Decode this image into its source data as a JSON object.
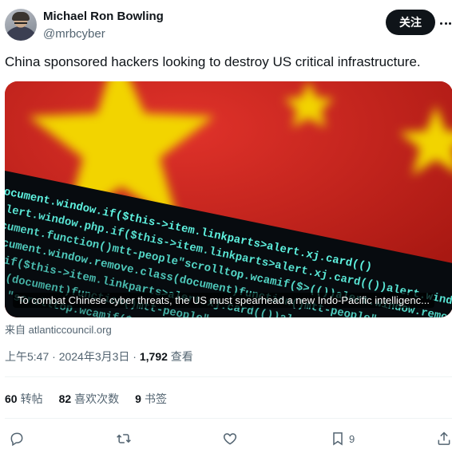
{
  "author": {
    "name": "Michael Ron Bowling",
    "handle": "@mrbcyber",
    "avatar_icon": "avatar-photo"
  },
  "follow_label": "关注",
  "tweet_text": "China sponsored hackers looking to destroy US critical infrastructure.",
  "card": {
    "caption": "To combat Chinese cyber threats, the US must spearhead a new Indo-Pacific intelligenc...",
    "code_lines": [
      "document.window.if($this->item.linkparts>alert.xj.card(()",
      "alert.window.php.if($this->item.linkparts>alert.xj.card(())alert.window.remove.class(docum",
      "cument.function()mtt-people\"scrolltop.wcamif($>(())alert.window.remove.class(document)function())mtt-people\"scrolltop.wc",
      "cument.window.remove.class(document)function()mtt-people\"scrolltop.wcamif($>(())alert.window.remove.class(docum",
      "if($this->item.linkparts>alert.xj.card(())alert.window.php.if($this->item.linkparts>alert",
      "(document)function()mtt-people\"scrolltop.wcamif($>(())alert.window",
      "\"scrolltop.wcamif($>(())alert.window.remove.class(docum"
    ]
  },
  "source": "来自 atlanticcouncil.org",
  "meta": {
    "time": "上午5:47 · 2024年3月3日 · ",
    "views_count": "1,792",
    "views_label": " 查看"
  },
  "stats": {
    "retweets_count": "60",
    "retweets_label": "转帖",
    "quotes_count": "82",
    "quotes_label": "喜欢次数",
    "bookmarks_count": "9",
    "bookmarks_label": "书签"
  },
  "actions": {
    "bookmark_count": "9"
  },
  "colors": {
    "flag_red": "#d52b1e",
    "flag_yellow": "#ffde00",
    "code_cyan": "#5ef2e0",
    "button_dark": "#0f1419",
    "secondary_text": "#536471"
  }
}
